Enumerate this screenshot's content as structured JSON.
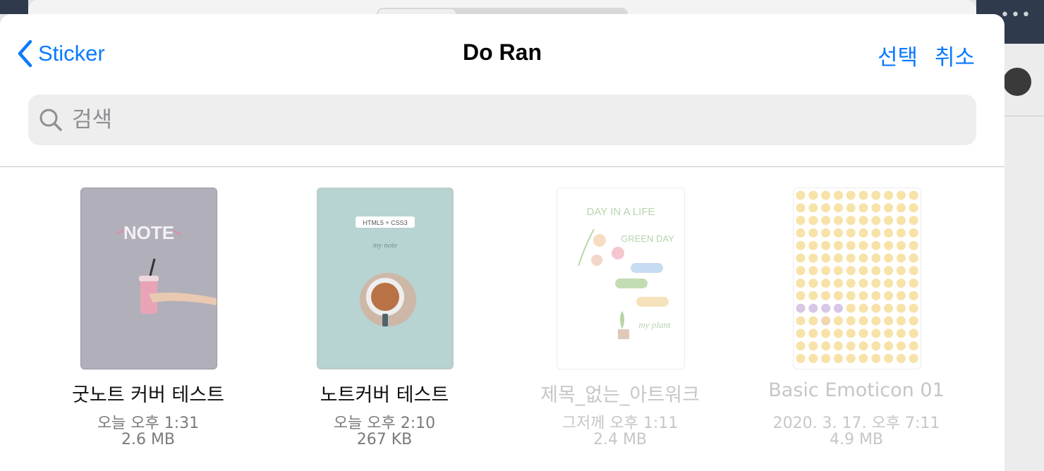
{
  "nav": {
    "back_label": "Sticker",
    "title": "Do Ran",
    "select_label": "선택",
    "cancel_label": "취소"
  },
  "search": {
    "placeholder": "검색"
  },
  "files": [
    {
      "name": "굿노트 커버 테스트",
      "date": "오늘 오후 1:31",
      "size": "2.6 MB",
      "thumb_text": "NOTE"
    },
    {
      "name": "노트커버 테스트",
      "date": "오늘 오후 2:10",
      "size": "267 KB",
      "thumb_text": "HTML5 + CSS3",
      "thumb_subtext": "my note"
    },
    {
      "name": "제목_없는_아트워크",
      "date": "그저께 오후 1:11",
      "size": "2.4 MB",
      "thumb_text": "DAY IN A LIFE",
      "thumb_text2": "GREEN DAY",
      "thumb_text3": "my plant"
    },
    {
      "name": "Basic Emoticon 01",
      "date": "2020. 3. 17. 오후 7:11",
      "size": "4.9 MB"
    }
  ],
  "colors": {
    "accent": "#0a7aff",
    "dim_text": "#c6c6c8"
  }
}
